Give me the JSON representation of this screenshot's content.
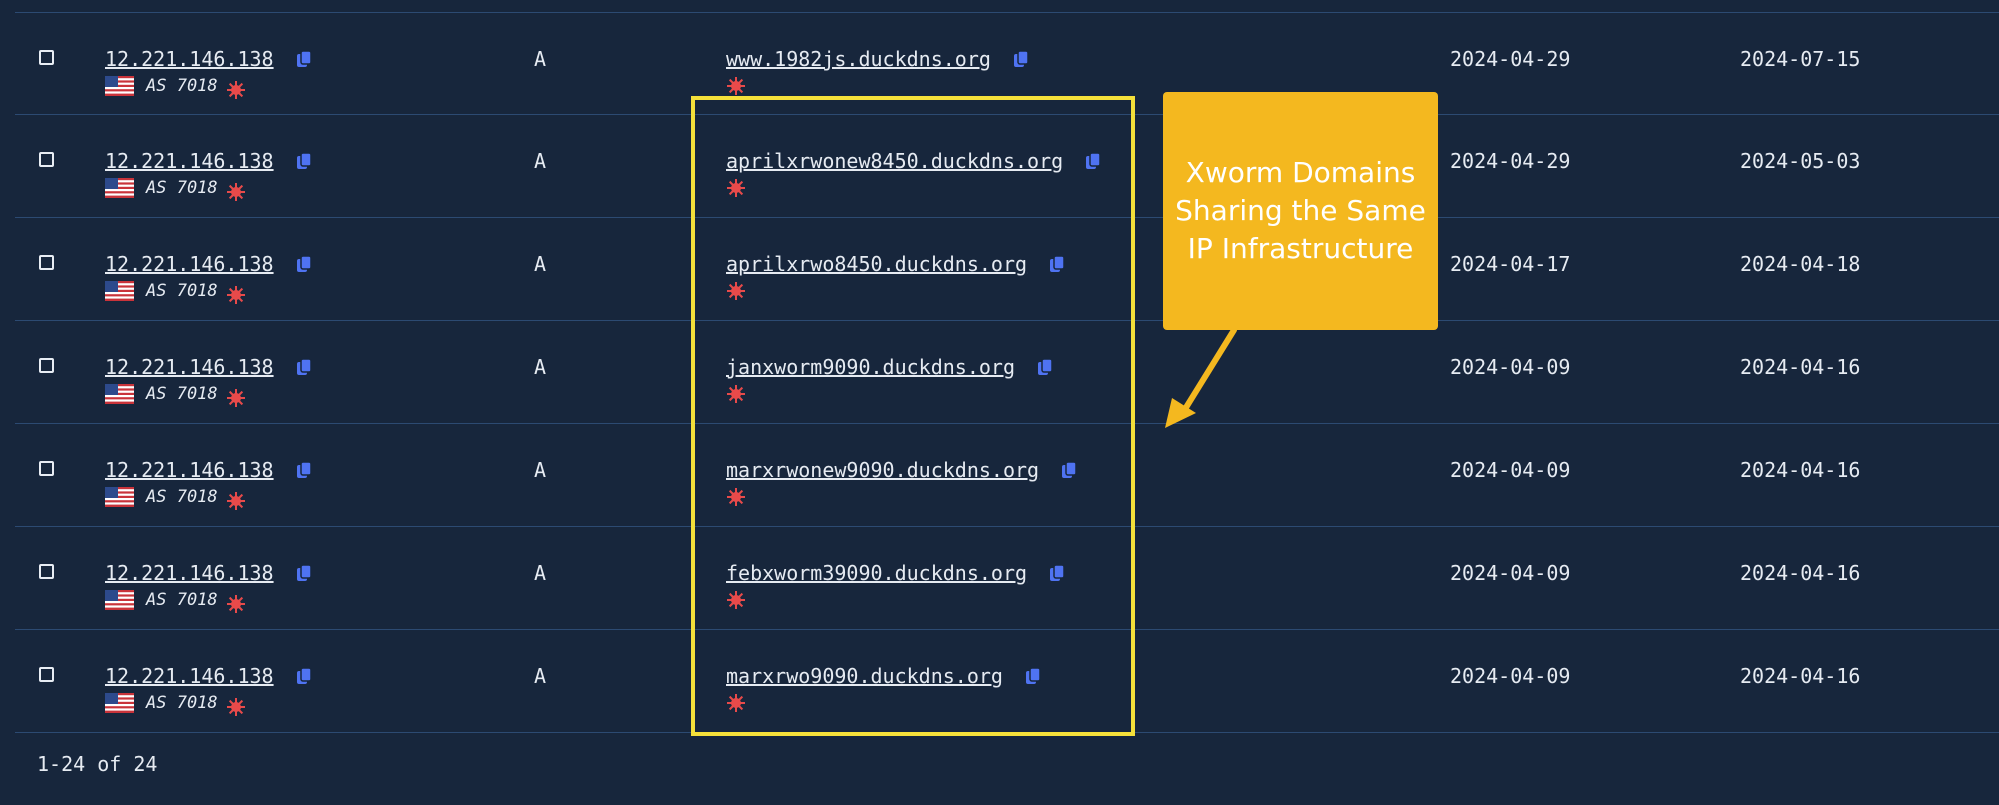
{
  "colors": {
    "background": "#17263c",
    "row_border": "#2c4a72",
    "copy_icon": "#4f73f2",
    "malware_icon": "#e84a4a",
    "highlight": "#f5e03a",
    "callout": "#f4b81f"
  },
  "rows": [
    {
      "ip": "12.221.146.138",
      "asn": "AS 7018",
      "type": "A",
      "domain": "www.1982js.duckdns.org",
      "first_seen": "2024-04-29",
      "last_seen": "2024-07-15"
    },
    {
      "ip": "12.221.146.138",
      "asn": "AS 7018",
      "type": "A",
      "domain": "aprilxrwonew8450.duckdns.org",
      "first_seen": "2024-04-29",
      "last_seen": "2024-05-03"
    },
    {
      "ip": "12.221.146.138",
      "asn": "AS 7018",
      "type": "A",
      "domain": "aprilxrwo8450.duckdns.org",
      "first_seen": "2024-04-17",
      "last_seen": "2024-04-18"
    },
    {
      "ip": "12.221.146.138",
      "asn": "AS 7018",
      "type": "A",
      "domain": "janxworm9090.duckdns.org",
      "first_seen": "2024-04-09",
      "last_seen": "2024-04-16"
    },
    {
      "ip": "12.221.146.138",
      "asn": "AS 7018",
      "type": "A",
      "domain": "marxrwonew9090.duckdns.org",
      "first_seen": "2024-04-09",
      "last_seen": "2024-04-16"
    },
    {
      "ip": "12.221.146.138",
      "asn": "AS 7018",
      "type": "A",
      "domain": "febxworm39090.duckdns.org",
      "first_seen": "2024-04-09",
      "last_seen": "2024-04-16"
    },
    {
      "ip": "12.221.146.138",
      "asn": "AS 7018",
      "type": "A",
      "domain": "marxrwo9090.duckdns.org",
      "first_seen": "2024-04-09",
      "last_seen": "2024-04-16"
    }
  ],
  "pagination": {
    "label": "1-24 of 24"
  },
  "callout": {
    "lines": [
      "Xworm Domains",
      "Sharing the Same",
      "IP Infrastructure"
    ]
  },
  "icons": {
    "copy": "copy-icon",
    "malware": "malware-icon",
    "flag": "us-flag-icon",
    "checkbox": "checkbox"
  }
}
